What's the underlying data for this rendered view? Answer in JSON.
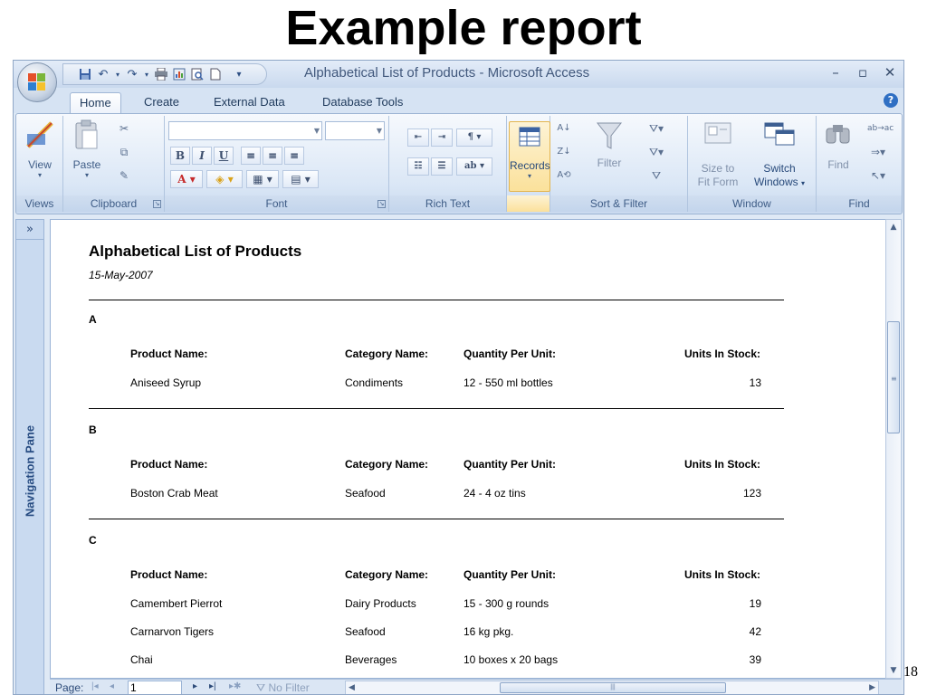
{
  "slide": {
    "title": "Example report",
    "page_number": "18"
  },
  "window": {
    "title": "Alphabetical List of Products - Microsoft Access"
  },
  "tabs": [
    {
      "label": "Home",
      "active": true
    },
    {
      "label": "Create",
      "active": false
    },
    {
      "label": "External Data",
      "active": false
    },
    {
      "label": "Database Tools",
      "active": false
    }
  ],
  "ribbon": {
    "groups": {
      "views": "Views",
      "clipboard": "Clipboard",
      "font": "Font",
      "rich_text": "Rich Text",
      "records": "",
      "sort_filter": "Sort & Filter",
      "window": "Window",
      "find": "Find"
    },
    "buttons": {
      "view": "View",
      "paste": "Paste",
      "records": "Records",
      "filter": "Filter",
      "size_to": "Size to",
      "fit_form": "Fit Form",
      "switch": "Switch",
      "windows": "Windows",
      "find": "Find"
    },
    "font_format": {
      "bold": "B",
      "italic": "I",
      "underline": "U"
    }
  },
  "nav_pane": {
    "label": "Navigation Pane",
    "toggle": "»"
  },
  "report": {
    "title": "Alphabetical List of Products",
    "date": "15-May-2007",
    "headers": {
      "product": "Product Name:",
      "category": "Category Name:",
      "quantity": "Quantity Per Unit:",
      "stock": "Units In Stock:"
    },
    "groups": [
      {
        "letter": "A",
        "rows": [
          {
            "product": "Aniseed Syrup",
            "category": "Condiments",
            "quantity": "12 - 550 ml bottles",
            "stock": "13"
          }
        ]
      },
      {
        "letter": "B",
        "rows": [
          {
            "product": "Boston Crab Meat",
            "category": "Seafood",
            "quantity": "24 - 4 oz tins",
            "stock": "123"
          }
        ]
      },
      {
        "letter": "C",
        "rows": [
          {
            "product": "Camembert Pierrot",
            "category": "Dairy Products",
            "quantity": "15 - 300 g rounds",
            "stock": "19"
          },
          {
            "product": "Carnarvon Tigers",
            "category": "Seafood",
            "quantity": "16 kg pkg.",
            "stock": "42"
          },
          {
            "product": "Chai",
            "category": "Beverages",
            "quantity": "10 boxes x 20 bags",
            "stock": "39"
          }
        ]
      }
    ]
  },
  "record_nav": {
    "label": "Page:",
    "value": "1",
    "no_filter": "No Filter"
  },
  "icons": [
    "office-icon",
    "save-icon",
    "undo-icon",
    "redo-icon",
    "print-icon",
    "help-icon",
    "view-icon",
    "paste-icon",
    "cut-icon",
    "copy-icon",
    "format-painter-icon",
    "records-icon",
    "filter-icon",
    "find-icon",
    "switch-windows-icon",
    "size-to-fit-icon"
  ]
}
